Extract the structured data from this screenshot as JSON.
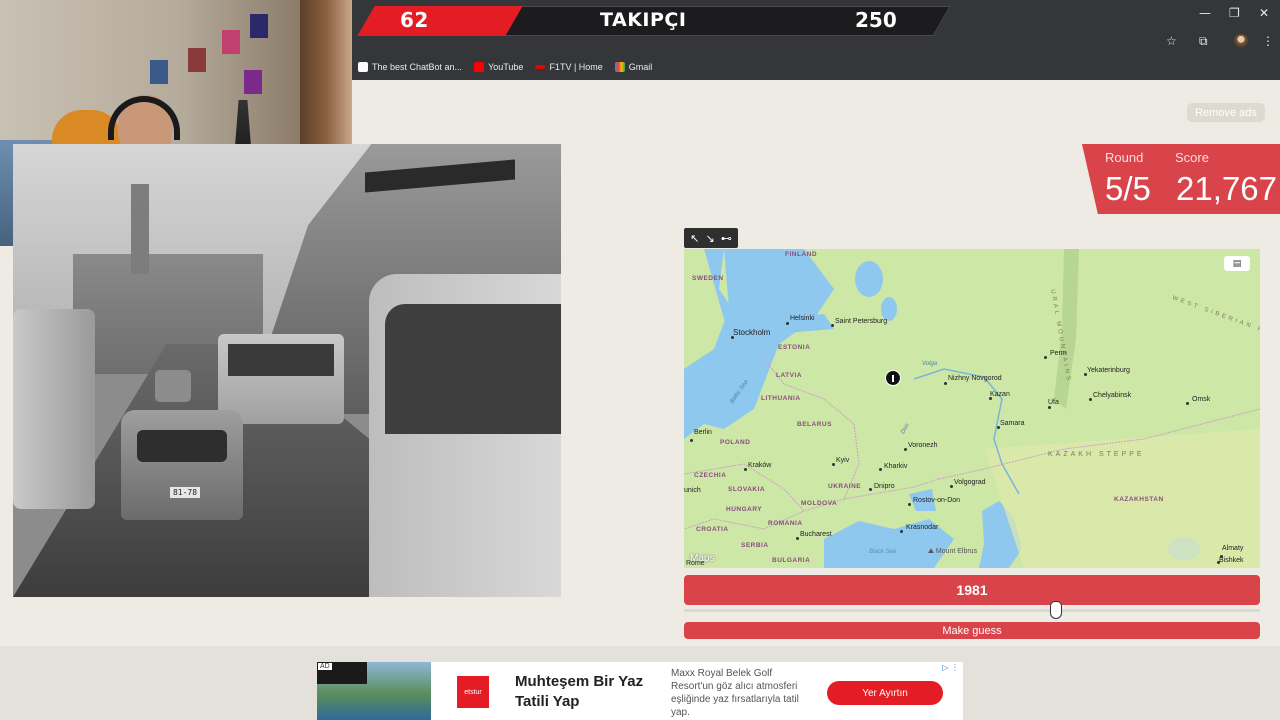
{
  "overlay": {
    "follower_current": "62",
    "follower_label": "TAKIPÇI",
    "follower_goal": "250"
  },
  "browser": {
    "bookmarks": [
      {
        "label": "The best ChatBot an...",
        "icon": "chatbot-favicon",
        "color": "#ffffff"
      },
      {
        "label": "YouTube",
        "icon": "youtube-favicon",
        "color": "#ff0000"
      },
      {
        "label": "F1TV | Home",
        "icon": "f1tv-favicon",
        "color": "#e10600"
      },
      {
        "label": "Gmail",
        "icon": "gmail-favicon",
        "color": "#ea4335"
      }
    ],
    "window_controls": [
      "—",
      "❐",
      "✕"
    ]
  },
  "page": {
    "remove_ads": "Remove ads",
    "round_label": "Round",
    "round_value": "5/5",
    "score_label": "Score",
    "score_value": "21,767",
    "accent_color": "#d9434a",
    "photo_plate": "81-78"
  },
  "map": {
    "attribution": "Maps",
    "cities": [
      "Stockholm",
      "Helsinki",
      "Saint Petersburg",
      "Berlin",
      "Nizhny Novgorod",
      "Kazan",
      "Perm",
      "Yekaterinburg",
      "Ufa",
      "Chelyabinsk",
      "Omsk",
      "Samara",
      "Voronezh",
      "Kharkiv",
      "Kyiv",
      "Kraków",
      "Dnipro",
      "Volgograd",
      "Rostov-on-Don",
      "Krasnodar",
      "Bucharest",
      "Almaty",
      "Bishkek",
      "unich",
      "Rome",
      "Mount Elbrus"
    ],
    "countries": [
      "FINLAND",
      "SWEDEN",
      "ESTONIA",
      "LATVIA",
      "LITHUANIA",
      "BELARUS",
      "POLAND",
      "UKRAINE",
      "CZECHIA",
      "SLOVAKIA",
      "HUNGARY",
      "MOLDOVA",
      "ROMANIA",
      "CROATIA",
      "SERBIA",
      "BULGARIA",
      "KAZAKHSTAN"
    ],
    "regions": [
      "KAZAKH STEPPE",
      "URAL MOUNTAINS",
      "WEST SIBERIAN PLA"
    ],
    "water": [
      "Black Sea",
      "Baltic Sea",
      "Volga",
      "Don"
    ]
  },
  "guess": {
    "year": "1981",
    "year_fraction": 0.645,
    "button_label": "Make guess"
  },
  "ad": {
    "tag": "AD",
    "logo_text": "etstur",
    "headline": "Muhteşem Bir Yaz Tatili Yap",
    "description": "Maxx Royal Belek Golf Resort'un göz alıcı atmosferi eşliğinde yaz fırsatlarıyla tatil yap.",
    "cta": "Yer Ayırtın"
  }
}
